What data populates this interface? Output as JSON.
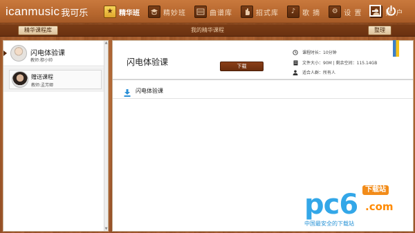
{
  "app": {
    "logo_en": "icanmusic",
    "logo_cn": "我可乐"
  },
  "nav": [
    {
      "label": "精华班",
      "icon": "star-emblem-icon",
      "active": true
    },
    {
      "label": "精妙班",
      "icon": "graduation-cap-icon",
      "active": false
    },
    {
      "label": "曲谱库",
      "icon": "music-score-icon",
      "active": false
    },
    {
      "label": "招式库",
      "icon": "hand-gesture-icon",
      "active": false
    },
    {
      "label": "歌 摘",
      "icon": "music-note-icon",
      "active": false
    },
    {
      "label": "设 置",
      "icon": "gear-icon",
      "active": false
    },
    {
      "label": "账 户",
      "icon": "user-account-icon",
      "active": false
    }
  ],
  "window": {
    "minimize_icon": "minimize-icon",
    "power_icon": "power-icon"
  },
  "subbar": {
    "left_button": "精华课程库",
    "title": "我的精华课程",
    "right_button": "整理"
  },
  "courses": [
    {
      "title": "闪电体验课",
      "teacher": "教师:穆小帅"
    },
    {
      "title": "赠送课程",
      "teacher": "教师:孟芳卿"
    }
  ],
  "detail": {
    "title": "闪电体验课",
    "download_label": "下载",
    "meta": [
      {
        "icon": "clock-icon",
        "text": "课程时长：10分钟"
      },
      {
        "icon": "file-icon",
        "text": "文件大小：90M | 剩余空间：115.14GB"
      },
      {
        "icon": "person-icon",
        "text": "适合人群：所有人"
      }
    ],
    "chapters": [
      {
        "title": "闪电体验课",
        "icon": "download-arrow-icon"
      }
    ],
    "bookmark_icon": "bookmark-ribbon-icon"
  },
  "watermark": {
    "main": "pc6",
    "badge": "下载站",
    "domain": ".com",
    "tagline": "中国最安全的下载站"
  },
  "colors": {
    "topbar": "#b8682f",
    "subbar": "#6a3110",
    "download_button": "#7a3414",
    "active_icon": "#f0c443",
    "chapter_icon": "#2a8fd6",
    "watermark_blue": "#33a7e8",
    "watermark_orange": "#ff8a00"
  }
}
